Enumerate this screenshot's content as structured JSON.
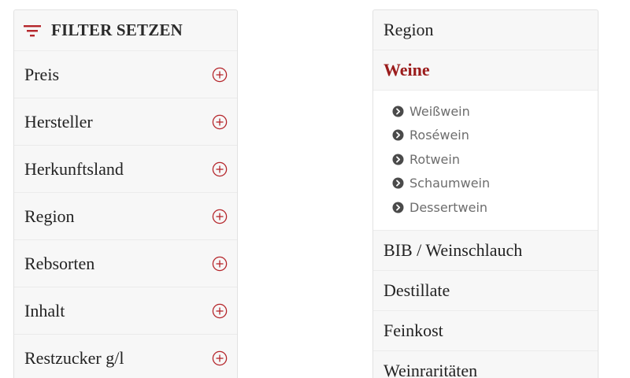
{
  "colors": {
    "accent": "#b5262b",
    "active_category": "#9b1c1c",
    "panel_background": "#f7f7f7",
    "text": "#222222",
    "subcategory_text": "#6d6d6d",
    "bullet": "#4a4a4a"
  },
  "filter": {
    "icon": "filter-icon",
    "title": "FILTER SETZEN",
    "items": [
      {
        "label": "Preis",
        "icon": "plus-circle-icon"
      },
      {
        "label": "Hersteller",
        "icon": "plus-circle-icon"
      },
      {
        "label": "Herkunftsland",
        "icon": "plus-circle-icon"
      },
      {
        "label": "Region",
        "icon": "plus-circle-icon"
      },
      {
        "label": "Rebsorten",
        "icon": "plus-circle-icon"
      },
      {
        "label": "Inhalt",
        "icon": "plus-circle-icon"
      },
      {
        "label": "Restzucker g/l",
        "icon": "plus-circle-icon"
      }
    ]
  },
  "categories": {
    "items": [
      {
        "label": "Region"
      },
      {
        "label": "Weine",
        "active": true
      },
      {
        "label": "BIB / Weinschlauch"
      },
      {
        "label": "Destillate"
      },
      {
        "label": "Feinkost"
      },
      {
        "label": "Weinraritäten"
      }
    ],
    "subcategories": [
      {
        "label": "Weißwein",
        "icon": "chevron-right-circle-icon"
      },
      {
        "label": "Roséwein",
        "icon": "chevron-right-circle-icon"
      },
      {
        "label": "Rotwein",
        "icon": "chevron-right-circle-icon"
      },
      {
        "label": "Schaumwein",
        "icon": "chevron-right-circle-icon"
      },
      {
        "label": "Dessertwein",
        "icon": "chevron-right-circle-icon"
      }
    ]
  }
}
